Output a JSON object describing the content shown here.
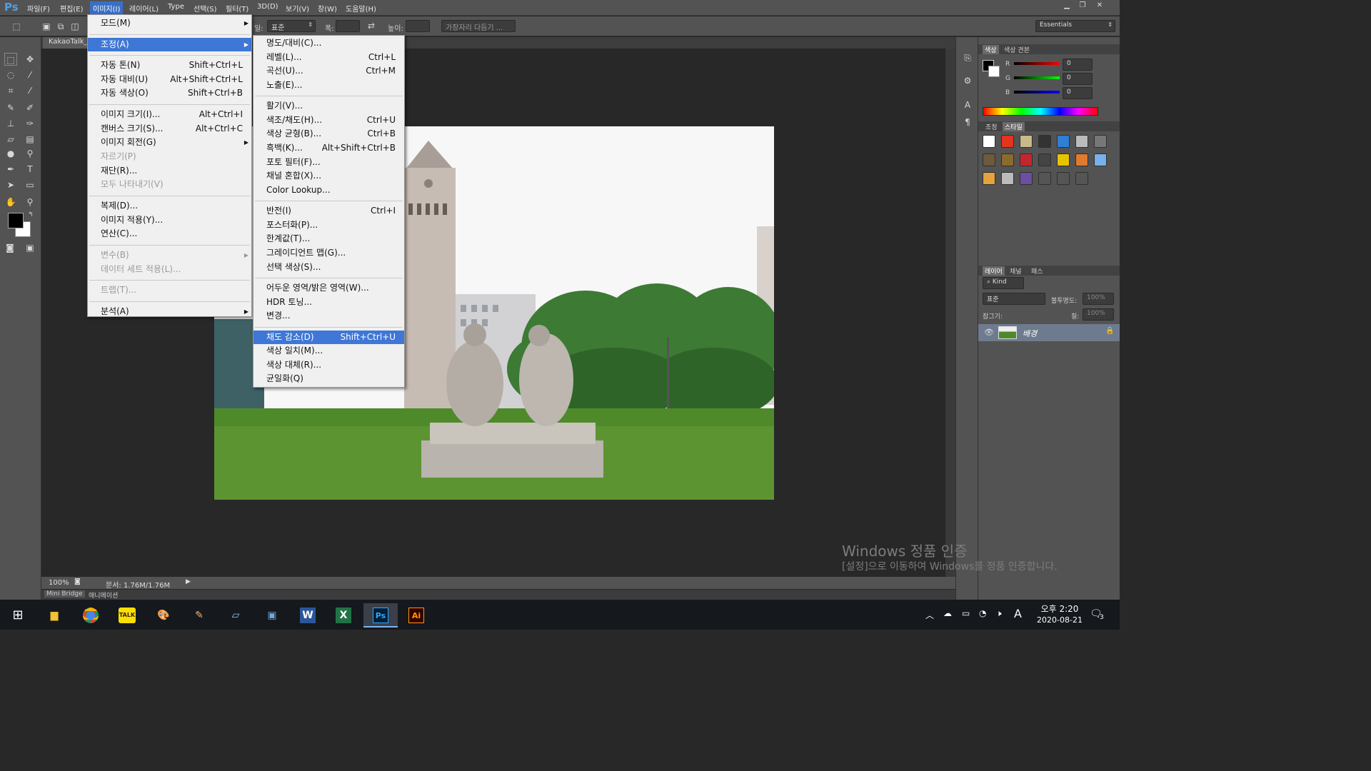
{
  "menubar": {
    "logo": "Ps",
    "items": [
      "파일(F)",
      "편집(E)",
      "이미지(I)",
      "레이어(L)",
      "Type",
      "선택(S)",
      "필터(T)",
      "3D(D)",
      "보기(V)",
      "창(W)",
      "도움말(H)"
    ]
  },
  "options": {
    "style_label": "일:",
    "style_value": "표준",
    "width_label": "폭:",
    "height_label": "높이:",
    "refine_edge": "가장자리 다듬기 ...",
    "workspace": "Essentials"
  },
  "document": {
    "tab_title": "KakaoTalk_2",
    "zoom": "100%",
    "doc_info": "문서: 1.76M/1.76M"
  },
  "bottom_tabs": [
    "Mini Bridge",
    "애니메이션"
  ],
  "image_menu": [
    {
      "label": "모드(M)",
      "submenu": true
    },
    {
      "sep": true
    },
    {
      "label": "조정(A)",
      "submenu": true,
      "highlight": true
    },
    {
      "sep": true
    },
    {
      "label": "자동 톤(N)",
      "shortcut": "Shift+Ctrl+L"
    },
    {
      "label": "자동 대비(U)",
      "shortcut": "Alt+Shift+Ctrl+L"
    },
    {
      "label": "자동 색상(O)",
      "shortcut": "Shift+Ctrl+B"
    },
    {
      "sep": true
    },
    {
      "label": "이미지 크기(I)...",
      "shortcut": "Alt+Ctrl+I"
    },
    {
      "label": "캔버스 크기(S)...",
      "shortcut": "Alt+Ctrl+C"
    },
    {
      "label": "이미지 회전(G)",
      "submenu": true
    },
    {
      "label": "자르기(P)",
      "disabled": true
    },
    {
      "label": "재단(R)..."
    },
    {
      "label": "모두 나타내기(V)",
      "disabled": true
    },
    {
      "sep": true
    },
    {
      "label": "복제(D)..."
    },
    {
      "label": "이미지 적용(Y)..."
    },
    {
      "label": "연산(C)..."
    },
    {
      "sep": true
    },
    {
      "label": "변수(B)",
      "submenu": true,
      "disabled": true
    },
    {
      "label": "데이터 세트 적용(L)...",
      "disabled": true
    },
    {
      "sep": true
    },
    {
      "label": "트랩(T)...",
      "disabled": true
    },
    {
      "sep": true
    },
    {
      "label": "분석(A)",
      "submenu": true
    }
  ],
  "adjust_menu": [
    {
      "label": "명도/대비(C)..."
    },
    {
      "label": "레벨(L)...",
      "shortcut": "Ctrl+L"
    },
    {
      "label": "곡선(U)...",
      "shortcut": "Ctrl+M"
    },
    {
      "label": "노출(E)..."
    },
    {
      "sep": true
    },
    {
      "label": "활기(V)..."
    },
    {
      "label": "색조/채도(H)...",
      "shortcut": "Ctrl+U"
    },
    {
      "label": "색상 균형(B)...",
      "shortcut": "Ctrl+B"
    },
    {
      "label": "흑백(K)...",
      "shortcut": "Alt+Shift+Ctrl+B"
    },
    {
      "label": "포토 필터(F)..."
    },
    {
      "label": "채널 혼합(X)..."
    },
    {
      "label": "Color Lookup..."
    },
    {
      "sep": true
    },
    {
      "label": "반전(I)",
      "shortcut": "Ctrl+I"
    },
    {
      "label": "포스터화(P)..."
    },
    {
      "label": "한계값(T)..."
    },
    {
      "label": "그레이디언트 맵(G)..."
    },
    {
      "label": "선택 색상(S)..."
    },
    {
      "sep": true
    },
    {
      "label": "어두운 영역/밝은 영역(W)..."
    },
    {
      "label": "HDR 토닝..."
    },
    {
      "label": "변경..."
    },
    {
      "sep": true
    },
    {
      "label": "채도 감소(D)",
      "shortcut": "Shift+Ctrl+U",
      "highlight": true
    },
    {
      "label": "색상 일치(M)..."
    },
    {
      "label": "색상 대체(R)..."
    },
    {
      "label": "균일화(Q)"
    }
  ],
  "color_panel": {
    "tabs": [
      "색상",
      "색상 견본"
    ],
    "channels": [
      {
        "name": "R",
        "value": "0"
      },
      {
        "name": "G",
        "value": "0"
      },
      {
        "name": "B",
        "value": "0"
      }
    ]
  },
  "styles_panel": {
    "tabs": [
      "조정",
      "스타일"
    ]
  },
  "layers_panel": {
    "tabs": [
      "레이어",
      "채널",
      "패스"
    ],
    "kind": "Kind",
    "blend": "표준",
    "opacity_label": "불투명도:",
    "opacity_value": "100%",
    "lock_label": "잠그기:",
    "fill_label": "칠:",
    "fill_value": "100%",
    "layer_name": "배경"
  },
  "watermark": {
    "line1": "Windows 정품 인증",
    "line2": "[설정]으로 이동하여 Windows를 정품 인증합니다."
  },
  "taskbar": {
    "time": "오후 2:20",
    "date": "2020-08-21",
    "ime": "A",
    "notifications": "3",
    "apps": [
      "start-icon",
      "file-explorer-icon",
      "chrome-icon",
      "kakaotalk-icon",
      "paint-icon",
      "paint3d-icon",
      "notes-icon",
      "store-icon",
      "word-icon",
      "excel-icon",
      "photoshop-icon",
      "illustrator-icon"
    ],
    "app_labels": {
      "kakaotalk": "TALK",
      "word": "W",
      "excel": "X",
      "photoshop": "Ps",
      "illustrator": "Ai"
    }
  },
  "colors": {
    "accent": "#3e77d6",
    "panel": "#535353",
    "canvas_bg": "#282828"
  }
}
